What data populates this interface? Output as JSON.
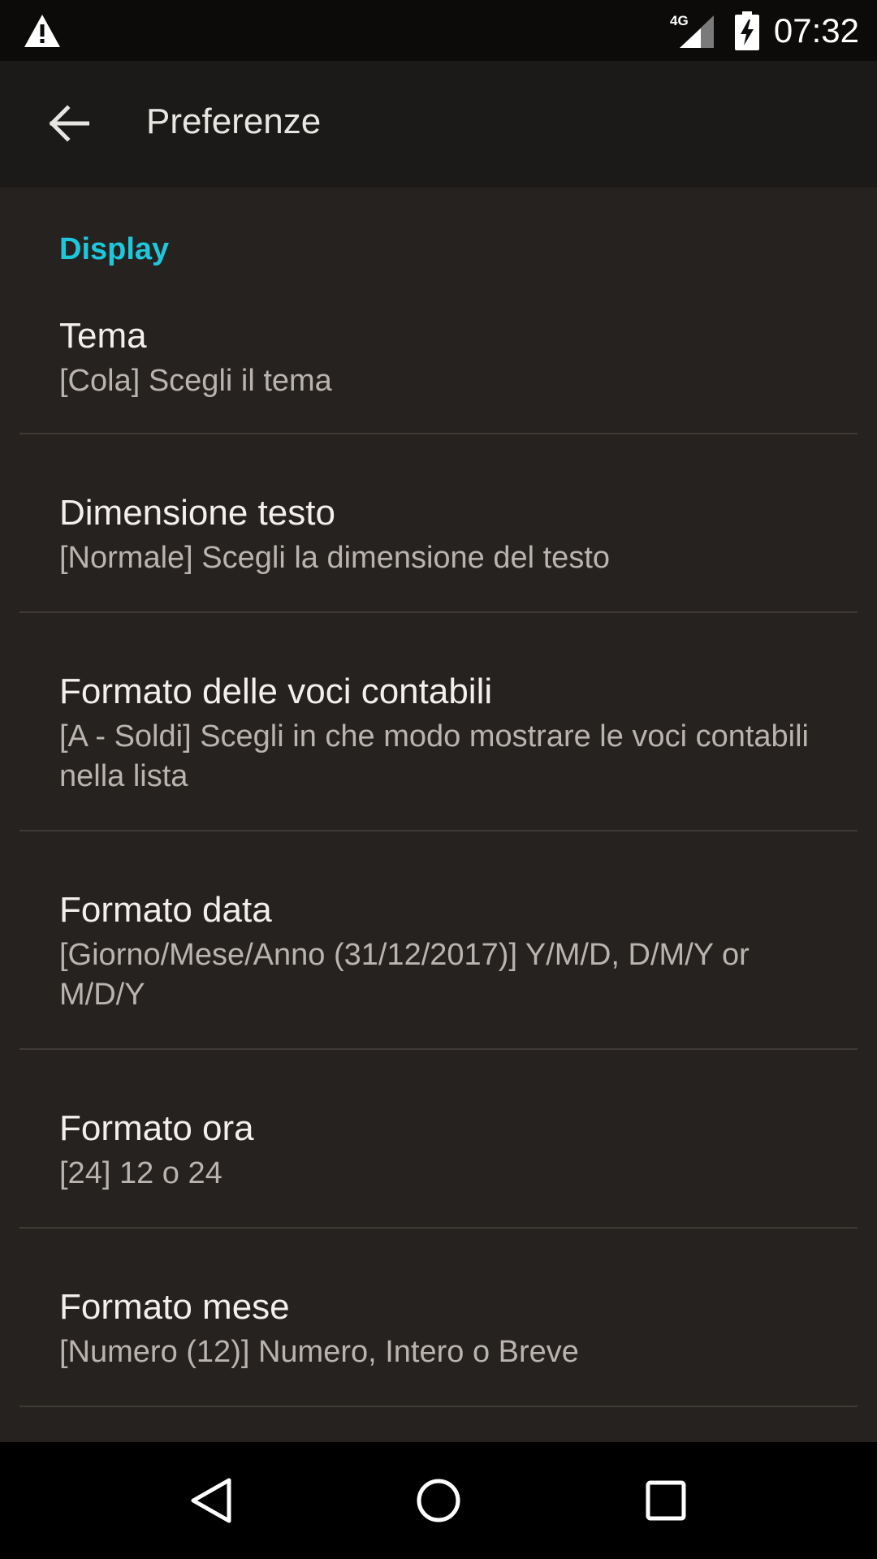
{
  "status_bar": {
    "network_label": "4G",
    "time": "07:32",
    "icons": [
      "warning-icon",
      "signal-icon",
      "battery-charging-icon"
    ]
  },
  "app_bar": {
    "title": "Preferenze",
    "back_icon": "arrow-back-icon"
  },
  "section": {
    "header": "Display"
  },
  "preferences": [
    {
      "title": "Tema",
      "summary": "[Cola] Scegli il tema"
    },
    {
      "title": "Dimensione testo",
      "summary": "[Normale] Scegli la dimensione del testo"
    },
    {
      "title": "Formato delle voci contabili",
      "summary": "[A - Soldi] Scegli in che modo mostrare le voci contabili nella lista"
    },
    {
      "title": "Formato data",
      "summary": "[Giorno/Mese/Anno (31/12/2017)] Y/M/D, D/M/Y or M/D/Y"
    },
    {
      "title": "Formato ora",
      "summary": "[24] 12 o 24"
    },
    {
      "title": "Formato mese",
      "summary": "[Numero (12)] Numero, Intero o Breve"
    }
  ],
  "nav_bar": {
    "icons": [
      "back-triangle-icon",
      "home-circle-icon",
      "recents-square-icon"
    ]
  },
  "colors": {
    "accent": "#1ec8dc",
    "background": "#26221f",
    "app_bar": "#1c1a18",
    "status_bar": "#0d0b0a"
  }
}
